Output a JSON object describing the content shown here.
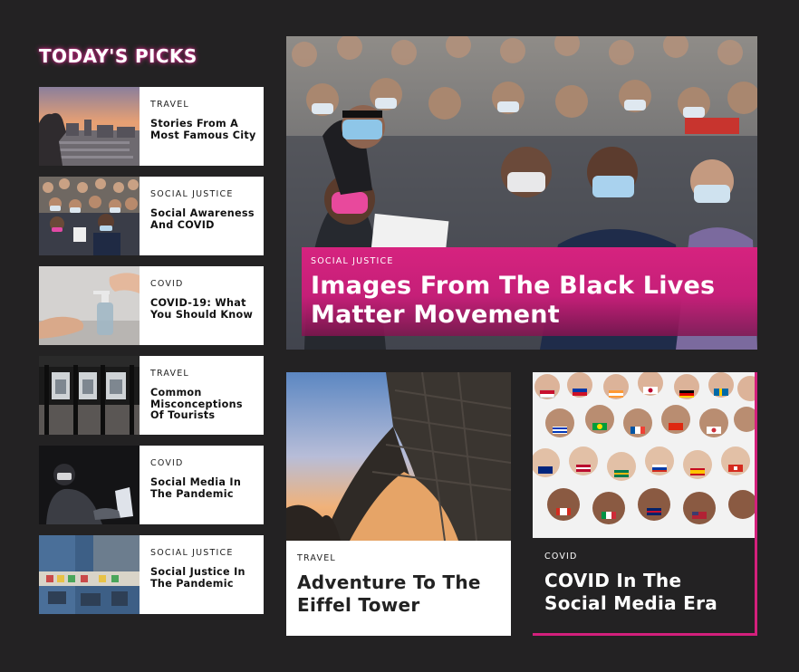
{
  "section_title": "TODAY'S PICKS",
  "picks": [
    {
      "category": "TRAVEL",
      "title": "Stories From A Most Famous City",
      "image": "city-skyline-gargoyle"
    },
    {
      "category": "SOCIAL JUSTICE",
      "title": "Social Awareness And COVID",
      "image": "masked-protest-crowd"
    },
    {
      "category": "COVID",
      "title": "COVID-19: What You Should Know",
      "image": "hand-sanitizer"
    },
    {
      "category": "TRAVEL",
      "title": "Common Misconceptions Of Tourists",
      "image": "subway-station"
    },
    {
      "category": "COVID",
      "title": "Social Media In The Pandemic",
      "image": "person-at-laptop-dark"
    },
    {
      "category": "SOCIAL JUSTICE",
      "title": "Social Justice In The Pandemic",
      "image": "street-mural-aerial"
    }
  ],
  "hero": {
    "category": "SOCIAL JUSTICE",
    "title": "Images From The Black Lives Matter Movement",
    "image": "black-lives-matter-march"
  },
  "cards": [
    {
      "category": "TRAVEL",
      "title": "Adventure To The Eiffel Tower",
      "image": "eiffel-tower-sunset"
    },
    {
      "category": "COVID",
      "title": "COVID In The Social Media Era",
      "image": "illustrated-crowd-flag-masks"
    }
  ],
  "colors": {
    "background": "#232223",
    "accent": "#d3207c",
    "card": "#ffffff",
    "text_dark": "#111111"
  }
}
